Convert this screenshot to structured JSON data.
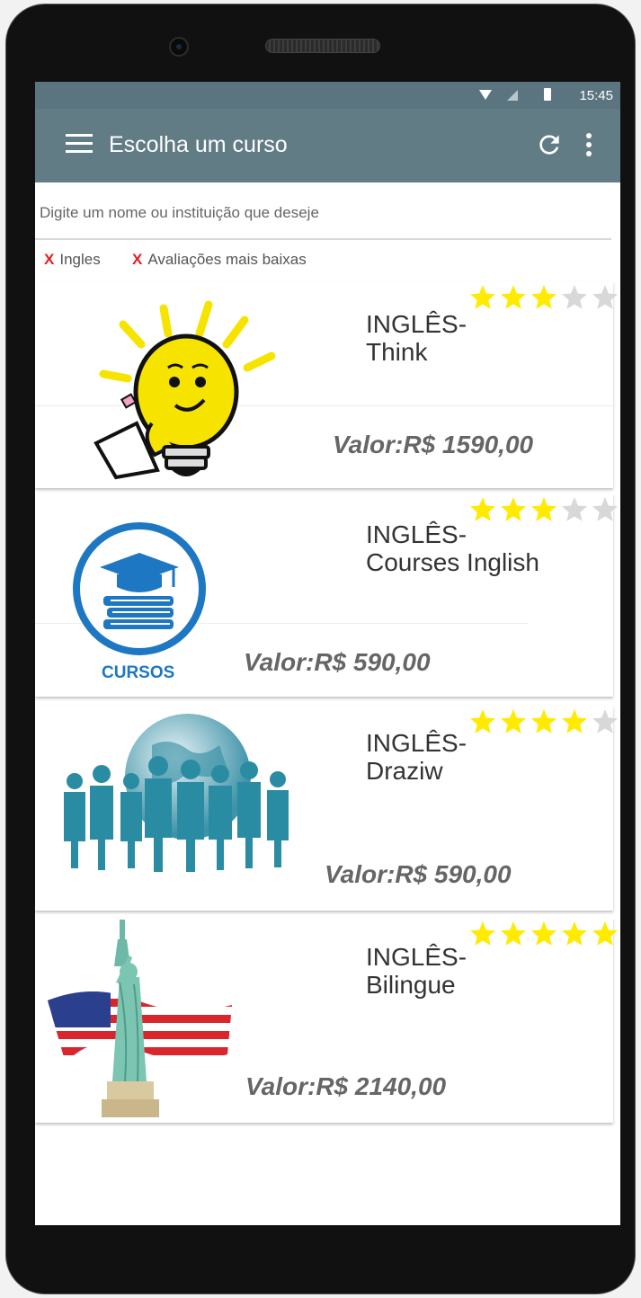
{
  "status": {
    "time": "15:45"
  },
  "app": {
    "title": "Escolha um curso"
  },
  "search": {
    "placeholder": "Digite um nome ou instituição que deseje"
  },
  "filters": [
    {
      "x": "X",
      "label": "Ingles"
    },
    {
      "x": "X",
      "label": "Avaliações mais baixas"
    }
  ],
  "courses": [
    {
      "name_line1": "INGLÊS-",
      "name_line2": "Think",
      "price": "Valor:R$ 1590,00",
      "rating": 3,
      "image": "lightbulb-thinking-icon"
    },
    {
      "name_line1": "INGLÊS-",
      "name_line2": "Courses Inglish",
      "price": "Valor:R$ 590,00",
      "rating": 3,
      "image": "cursos-logo",
      "logo_text": "CURSOS"
    },
    {
      "name_line1": "INGLÊS-",
      "name_line2": "Draziw",
      "price": "Valor:R$ 590,00",
      "rating": 4,
      "image": "business-people-globe-icon"
    },
    {
      "name_line1": "INGLÊS-",
      "name_line2": "Bilingue",
      "price": "Valor:R$ 2140,00",
      "rating": 5,
      "image": "statue-of-liberty-flag-icon"
    }
  ],
  "colors": {
    "star_on": "#ffeb00",
    "star_off": "#d8d8d8",
    "appbar": "#627c86",
    "statusbar": "#5b7580"
  }
}
